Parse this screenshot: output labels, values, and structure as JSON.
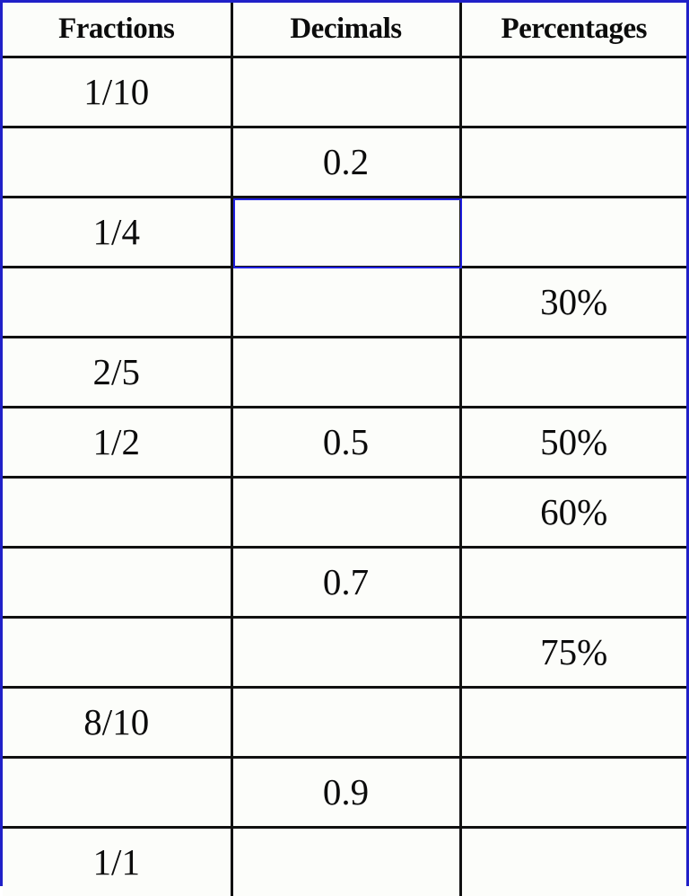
{
  "table": {
    "name": "fractions-decimals-percentages",
    "columns": [
      "Fractions",
      "Decimals",
      "Percentages"
    ],
    "selected_cell": {
      "row": 2,
      "column": 1
    },
    "colors": {
      "outer_border": "#2020c8",
      "grid_line": "#111111",
      "selection_border": "#2020e0",
      "background": "#fcfdfa",
      "text": "#0c0c0c"
    },
    "rows": [
      {
        "fractions": "1/10",
        "decimals": "",
        "percentages": ""
      },
      {
        "fractions": "",
        "decimals": "0.2",
        "percentages": ""
      },
      {
        "fractions": "1/4",
        "decimals": "",
        "percentages": ""
      },
      {
        "fractions": "",
        "decimals": "",
        "percentages": "30%"
      },
      {
        "fractions": "2/5",
        "decimals": "",
        "percentages": ""
      },
      {
        "fractions": "1/2",
        "decimals": "0.5",
        "percentages": "50%"
      },
      {
        "fractions": "",
        "decimals": "",
        "percentages": "60%"
      },
      {
        "fractions": "",
        "decimals": "0.7",
        "percentages": ""
      },
      {
        "fractions": "",
        "decimals": "",
        "percentages": "75%"
      },
      {
        "fractions": "8/10",
        "decimals": "",
        "percentages": ""
      },
      {
        "fractions": "",
        "decimals": "0.9",
        "percentages": ""
      },
      {
        "fractions": "1/1",
        "decimals": "",
        "percentages": ""
      }
    ]
  }
}
